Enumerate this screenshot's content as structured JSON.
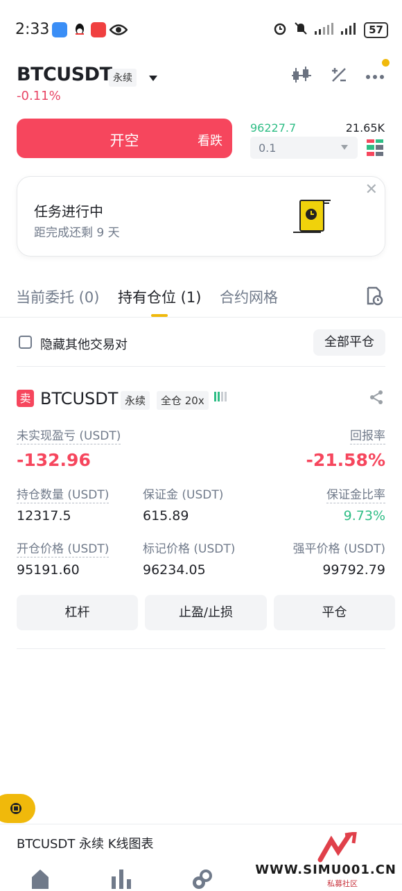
{
  "status_bar": {
    "time": "2:33",
    "battery": "57"
  },
  "header": {
    "pair": "BTCUSDT",
    "contract_tag": "永续",
    "change": "-0.11%"
  },
  "trade": {
    "short_button_label": "开空",
    "short_button_sub": "看跌",
    "last_price": "96227.7",
    "volume": "21.65K",
    "quantity_value": "0.1"
  },
  "task_card": {
    "title": "任务进行中",
    "subtitle": "距完成还剩 9 天"
  },
  "tabs": [
    {
      "label": "当前委托 (0)",
      "active": false
    },
    {
      "label": "持有仓位 (1)",
      "active": true
    },
    {
      "label": "合约网格",
      "active": false
    }
  ],
  "filter": {
    "hide_label": "隐藏其他交易对",
    "close_all_label": "全部平仓"
  },
  "position": {
    "side_badge": "卖",
    "symbol": "BTCUSDT",
    "contract_tag": "永续",
    "margin_tag": "全仓 20x",
    "unrealized_label": "未实现盈亏 (USDT)",
    "unrealized_value": "-132.96",
    "roe_label": "回报率",
    "roe_value": "-21.58%",
    "size_label": "持仓数量 (USDT)",
    "size_value": "12317.5",
    "margin_label": "保证金 (USDT)",
    "margin_value": "615.89",
    "margin_ratio_label": "保证金比率",
    "margin_ratio_value": "9.73%",
    "entry_label": "开仓价格 (USDT)",
    "entry_value": "95191.60",
    "mark_label": "标记价格 (USDT)",
    "mark_value": "96234.05",
    "liq_label": "强平价格 (USDT)",
    "liq_value": "99792.79",
    "buttons": [
      "杠杆",
      "止盈/止损",
      "平仓"
    ]
  },
  "bottom": {
    "kline_label": "BTCUSDT 永续 K线图表",
    "watermark": "WWW.SIMU001.CN",
    "watermark_sub": "私募社区"
  },
  "colors": {
    "accent": "#f0b90b",
    "sell": "#f6465d",
    "buy": "#2ebd85"
  }
}
